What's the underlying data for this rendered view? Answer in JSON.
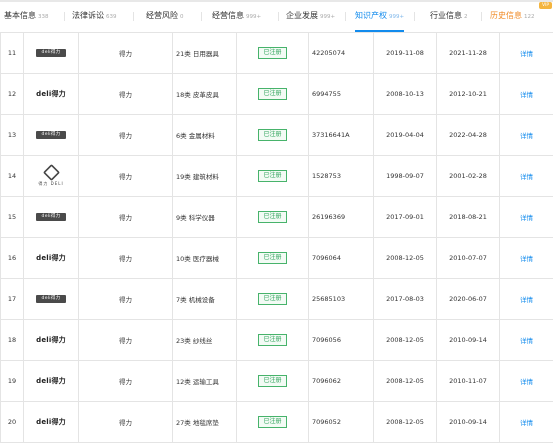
{
  "tabs": [
    {
      "label": "基本信息",
      "count": "338"
    },
    {
      "label": "法律诉讼",
      "count": "639"
    },
    {
      "label": "经营风险",
      "count": "0"
    },
    {
      "label": "经营信息",
      "count": "999+"
    },
    {
      "label": "企业发展",
      "count": "999+"
    },
    {
      "label": "知识产权",
      "count": "999+"
    },
    {
      "label": "行业信息",
      "count": "2"
    },
    {
      "label": "历史信息",
      "count": "122"
    }
  ],
  "vip_badge": "VIP",
  "rows": [
    {
      "idx": "11",
      "logo_text": "deli得力",
      "logo_style": "box",
      "status": "得力",
      "tm_class": "21类 日用器具",
      "status_tag": "已注册",
      "reg_no": "42205074",
      "apply_date": "2019-11-08",
      "expire_date": "2021-11-28",
      "detail": "详情"
    },
    {
      "idx": "12",
      "logo_text": "deli得力",
      "logo_style": "text",
      "status": "得力",
      "tm_class": "18类 皮革皮具",
      "status_tag": "已注册",
      "reg_no": "6994755",
      "apply_date": "2008-10-13",
      "expire_date": "2012-10-21",
      "detail": "详情"
    },
    {
      "idx": "13",
      "logo_text": "deli得力",
      "logo_style": "box",
      "status": "得力",
      "tm_class": "6类 金属材料",
      "status_tag": "已注册",
      "reg_no": "37316641A",
      "apply_date": "2019-04-04",
      "expire_date": "2022-04-28",
      "detail": "详情"
    },
    {
      "idx": "14",
      "logo_text": "得力 DELI",
      "logo_style": "stack",
      "status": "得力",
      "tm_class": "19类 建筑材料",
      "status_tag": "已注册",
      "reg_no": "1528753",
      "apply_date": "1998-09-07",
      "expire_date": "2001-02-28",
      "detail": "详情"
    },
    {
      "idx": "15",
      "logo_text": "deli得力",
      "logo_style": "box",
      "status": "得力",
      "tm_class": "9类 科学仪器",
      "status_tag": "已注册",
      "reg_no": "26196369",
      "apply_date": "2017-09-01",
      "expire_date": "2018-08-21",
      "detail": "详情"
    },
    {
      "idx": "16",
      "logo_text": "deli得力",
      "logo_style": "text",
      "status": "得力",
      "tm_class": "10类 医疗器械",
      "status_tag": "已注册",
      "reg_no": "7096064",
      "apply_date": "2008-12-05",
      "expire_date": "2010-07-07",
      "detail": "详情"
    },
    {
      "idx": "17",
      "logo_text": "deli得力",
      "logo_style": "box",
      "status": "得力",
      "tm_class": "7类 机械设备",
      "status_tag": "已注册",
      "reg_no": "25685103",
      "apply_date": "2017-08-03",
      "expire_date": "2020-06-07",
      "detail": "详情"
    },
    {
      "idx": "18",
      "logo_text": "deli得力",
      "logo_style": "text",
      "status": "得力",
      "tm_class": "23类 纱线丝",
      "status_tag": "已注册",
      "reg_no": "7096056",
      "apply_date": "2008-12-05",
      "expire_date": "2010-09-14",
      "detail": "详情"
    },
    {
      "idx": "19",
      "logo_text": "deli得力",
      "logo_style": "text",
      "status": "得力",
      "tm_class": "12类 运输工具",
      "status_tag": "已注册",
      "reg_no": "7096062",
      "apply_date": "2008-12-05",
      "expire_date": "2010-11-07",
      "detail": "详情"
    },
    {
      "idx": "20",
      "logo_text": "deli得力",
      "logo_style": "text",
      "status": "得力",
      "tm_class": "27类 地毯席垫",
      "status_tag": "已注册",
      "reg_no": "7096052",
      "apply_date": "2008-12-05",
      "expire_date": "2010-09-14",
      "detail": "详情"
    }
  ],
  "colors": {
    "accent": "#128bed",
    "status_red": "#e64a3b",
    "tag_green": "#2ea35a",
    "history_orange": "#f08a24"
  }
}
